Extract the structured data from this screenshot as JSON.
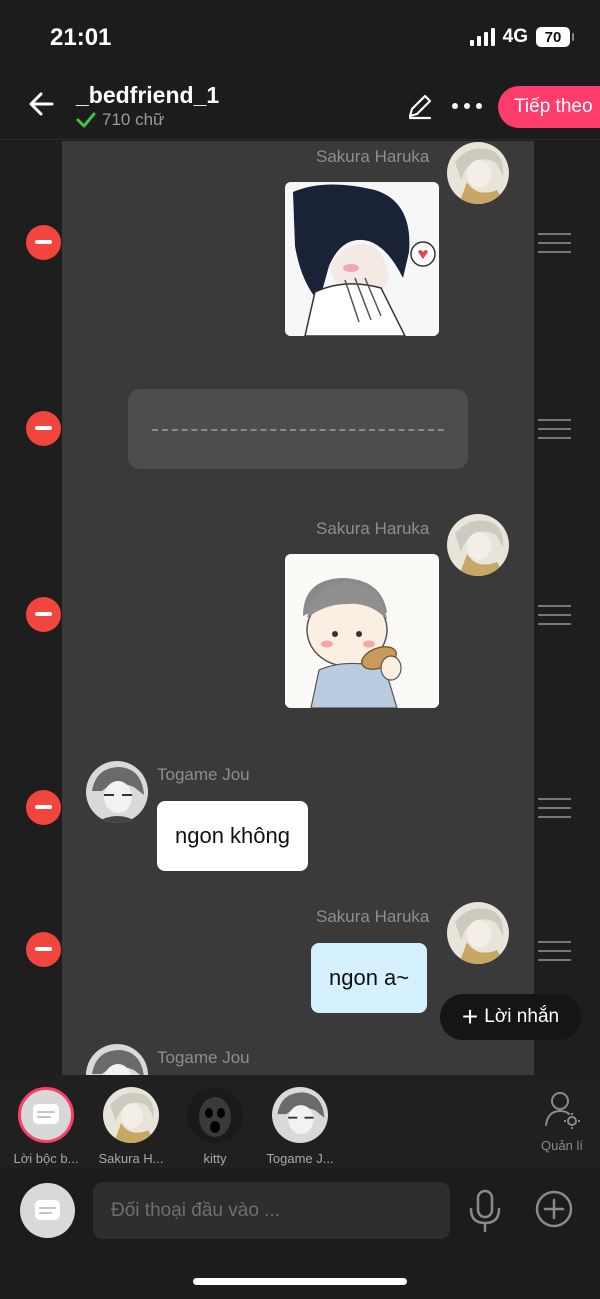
{
  "status_bar": {
    "time": "21:01",
    "network": "4G",
    "battery": "70"
  },
  "header": {
    "title": "_bedfriend_1",
    "word_count": "710 chữ",
    "next_label": "Tiếp theo"
  },
  "messages": [
    {
      "type": "image",
      "side": "right",
      "sender": "Sakura Haruka",
      "image_icon": "manga-boy-blushing-image"
    },
    {
      "type": "narration",
      "side": "center"
    },
    {
      "type": "image",
      "side": "right",
      "sender": "Sakura Haruka",
      "image_icon": "boy-eating-image"
    },
    {
      "type": "text",
      "side": "left",
      "sender": "Togame Jou",
      "text": "ngon không"
    },
    {
      "type": "text",
      "side": "right",
      "sender": "Sakura Haruka",
      "text": "ngon a~"
    },
    {
      "type": "partial",
      "side": "left",
      "sender": "Togame Jou"
    }
  ],
  "add_message_label": "Lời nhắn",
  "characters": [
    {
      "label": "Lời bộc b...",
      "selected": true
    },
    {
      "label": "Sakura H..."
    },
    {
      "label": "kitty"
    },
    {
      "label": "Togame J..."
    }
  ],
  "manage_label": "Quản lí",
  "input": {
    "placeholder": "Đối thoại đầu vào ..."
  },
  "colors": {
    "accent": "#ff3d6c",
    "delete": "#f2453d",
    "right_bubble": "#d4f1fd"
  }
}
